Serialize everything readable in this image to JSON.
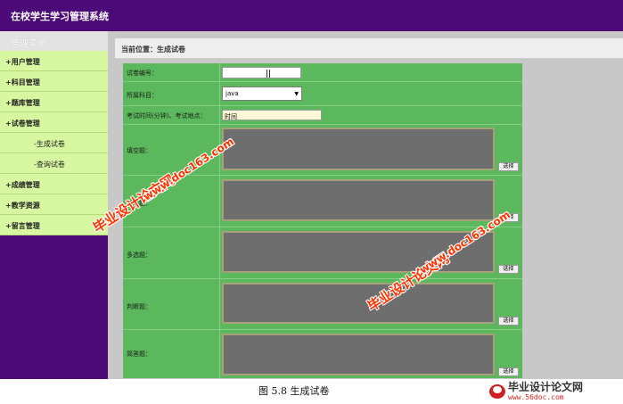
{
  "app_title": "在校学生学习管理系统",
  "sidebar": {
    "header": "管理菜单",
    "items": [
      {
        "label": "+用户管理"
      },
      {
        "label": "+科目管理"
      },
      {
        "label": "+题库管理"
      },
      {
        "label": "+试卷管理"
      },
      {
        "label": "-生成试卷"
      },
      {
        "label": "-查询试卷"
      },
      {
        "label": "+成绩管理"
      },
      {
        "label": "+教学资源"
      },
      {
        "label": "+留言管理"
      }
    ]
  },
  "breadcrumb": "当前位置：生成试卷",
  "form": {
    "paper_no_label": "试卷编号：",
    "paper_no_value": "",
    "subject_label": "所属科目：",
    "subject_value": "java",
    "time_place_label": "考试时间(分钟)、考试地点：",
    "time_value": "时间",
    "fill_blank_label": "填空题：",
    "single_choice_label": "单选题：",
    "multi_choice_label": "多选题：",
    "judge_label": "判断题：",
    "short_answer_label": "简答题：",
    "choose_button": "选择"
  },
  "caption": "图 5.8  生成试卷",
  "watermarks": {
    "site": "毕业设计论文网",
    "url": "www.doc163.com"
  },
  "logo": {
    "name": "毕业设计论文网",
    "url": "www.56doc.com"
  }
}
